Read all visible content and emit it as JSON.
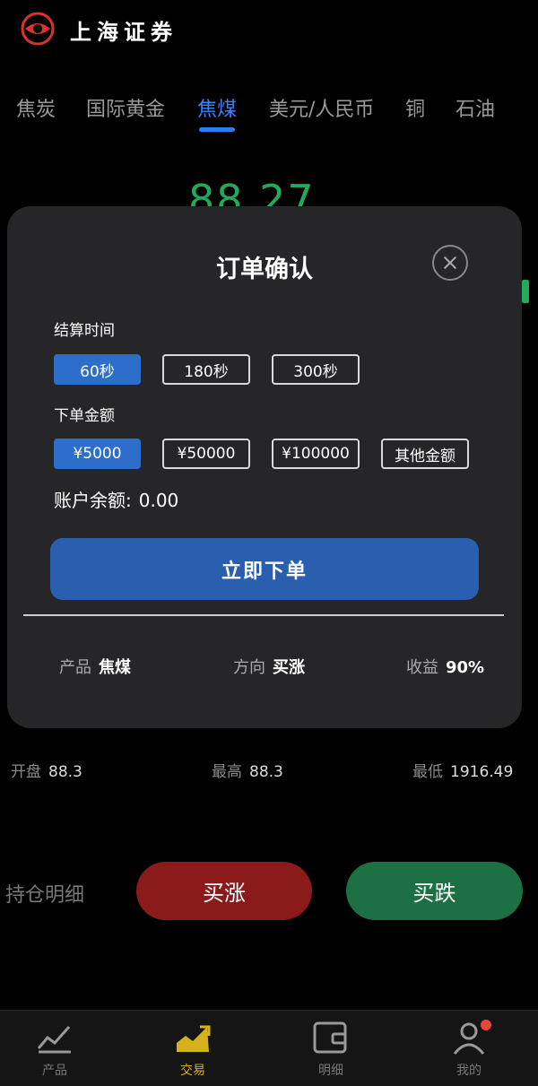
{
  "header": {
    "brand": "上海证券"
  },
  "tabs": [
    {
      "label": "焦炭"
    },
    {
      "label": "国际黄金"
    },
    {
      "label": "焦煤"
    },
    {
      "label": "美元/人民币"
    },
    {
      "label": "铜"
    },
    {
      "label": "石油"
    }
  ],
  "active_tab": "焦煤",
  "price": "88.27",
  "modal": {
    "title": "订单确认",
    "settle_label": "结算时间",
    "settle_options": [
      "60秒",
      "180秒",
      "300秒"
    ],
    "settle_selected": "60秒",
    "amount_label": "下单金额",
    "amount_options": [
      "¥5000",
      "¥50000",
      "¥100000",
      "其他金额"
    ],
    "amount_selected": "¥5000",
    "balance_label": "账户余额:",
    "balance_value": "0.00",
    "submit_label": "立即下单",
    "product_label": "产品",
    "product_value": "焦煤",
    "direction_label": "方向",
    "direction_value": "买涨",
    "yield_label": "收益",
    "yield_value": "90%"
  },
  "stats": {
    "open_label": "开盘",
    "open_value": "88.3",
    "high_label": "最高",
    "high_value": "88.3",
    "low_label": "最低",
    "low_value": "1916.49"
  },
  "actions": {
    "hold_label": "持仓明细",
    "up_label": "买涨",
    "down_label": "买跌"
  },
  "nav": [
    {
      "label": "产品",
      "icon": "chart-icon"
    },
    {
      "label": "交易",
      "icon": "trade-icon"
    },
    {
      "label": "明细",
      "icon": "wallet-icon"
    },
    {
      "label": "我的",
      "icon": "user-icon"
    }
  ],
  "colors": {
    "accent": "#2f7cf6",
    "up": "#8b1a1a",
    "down": "#1d6f44",
    "price": "#1faa5e",
    "nav_active": "#d4b21a"
  }
}
